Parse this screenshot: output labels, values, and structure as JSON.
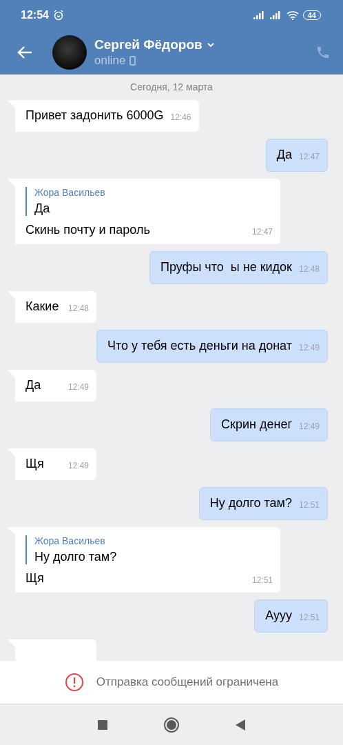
{
  "status_bar": {
    "time": "12:54",
    "battery": "44"
  },
  "header": {
    "name": "Сергей Фёдоров",
    "status": "online"
  },
  "date_label": "Сегодня, 12 марта",
  "messages": [
    {
      "kind": "incoming",
      "text": "Привет задонить 6000G",
      "time": "12:46"
    },
    {
      "kind": "outgoing",
      "text": "Да",
      "time": "12:47"
    },
    {
      "kind": "incoming",
      "reply": {
        "author": "Жора Васильев",
        "text": "Да"
      },
      "text": "Скинь почту и пароль",
      "time": "12:47"
    },
    {
      "kind": "outgoing",
      "text": "Пруфы что  ы не кидок",
      "time": "12:48"
    },
    {
      "kind": "incoming",
      "text": "Какие",
      "time": "12:48"
    },
    {
      "kind": "outgoing",
      "text": "Что у тебя есть деньги на донат",
      "time": "12:49"
    },
    {
      "kind": "incoming",
      "text": "Да",
      "time": "12:49"
    },
    {
      "kind": "outgoing",
      "text": "Скрин денег",
      "time": "12:49"
    },
    {
      "kind": "incoming",
      "text": "Щя",
      "time": "12:49"
    },
    {
      "kind": "outgoing",
      "text": "Ну долго там?",
      "time": "12:51"
    },
    {
      "kind": "incoming",
      "reply": {
        "author": "Жора Васильев",
        "text": "Ну долго там?"
      },
      "text": "Щя",
      "time": "12:51"
    },
    {
      "kind": "outgoing",
      "text": "Аууу",
      "time": "12:51"
    },
    {
      "kind": "incoming"
    }
  ],
  "notice": "Отправка сообщений ограничена"
}
